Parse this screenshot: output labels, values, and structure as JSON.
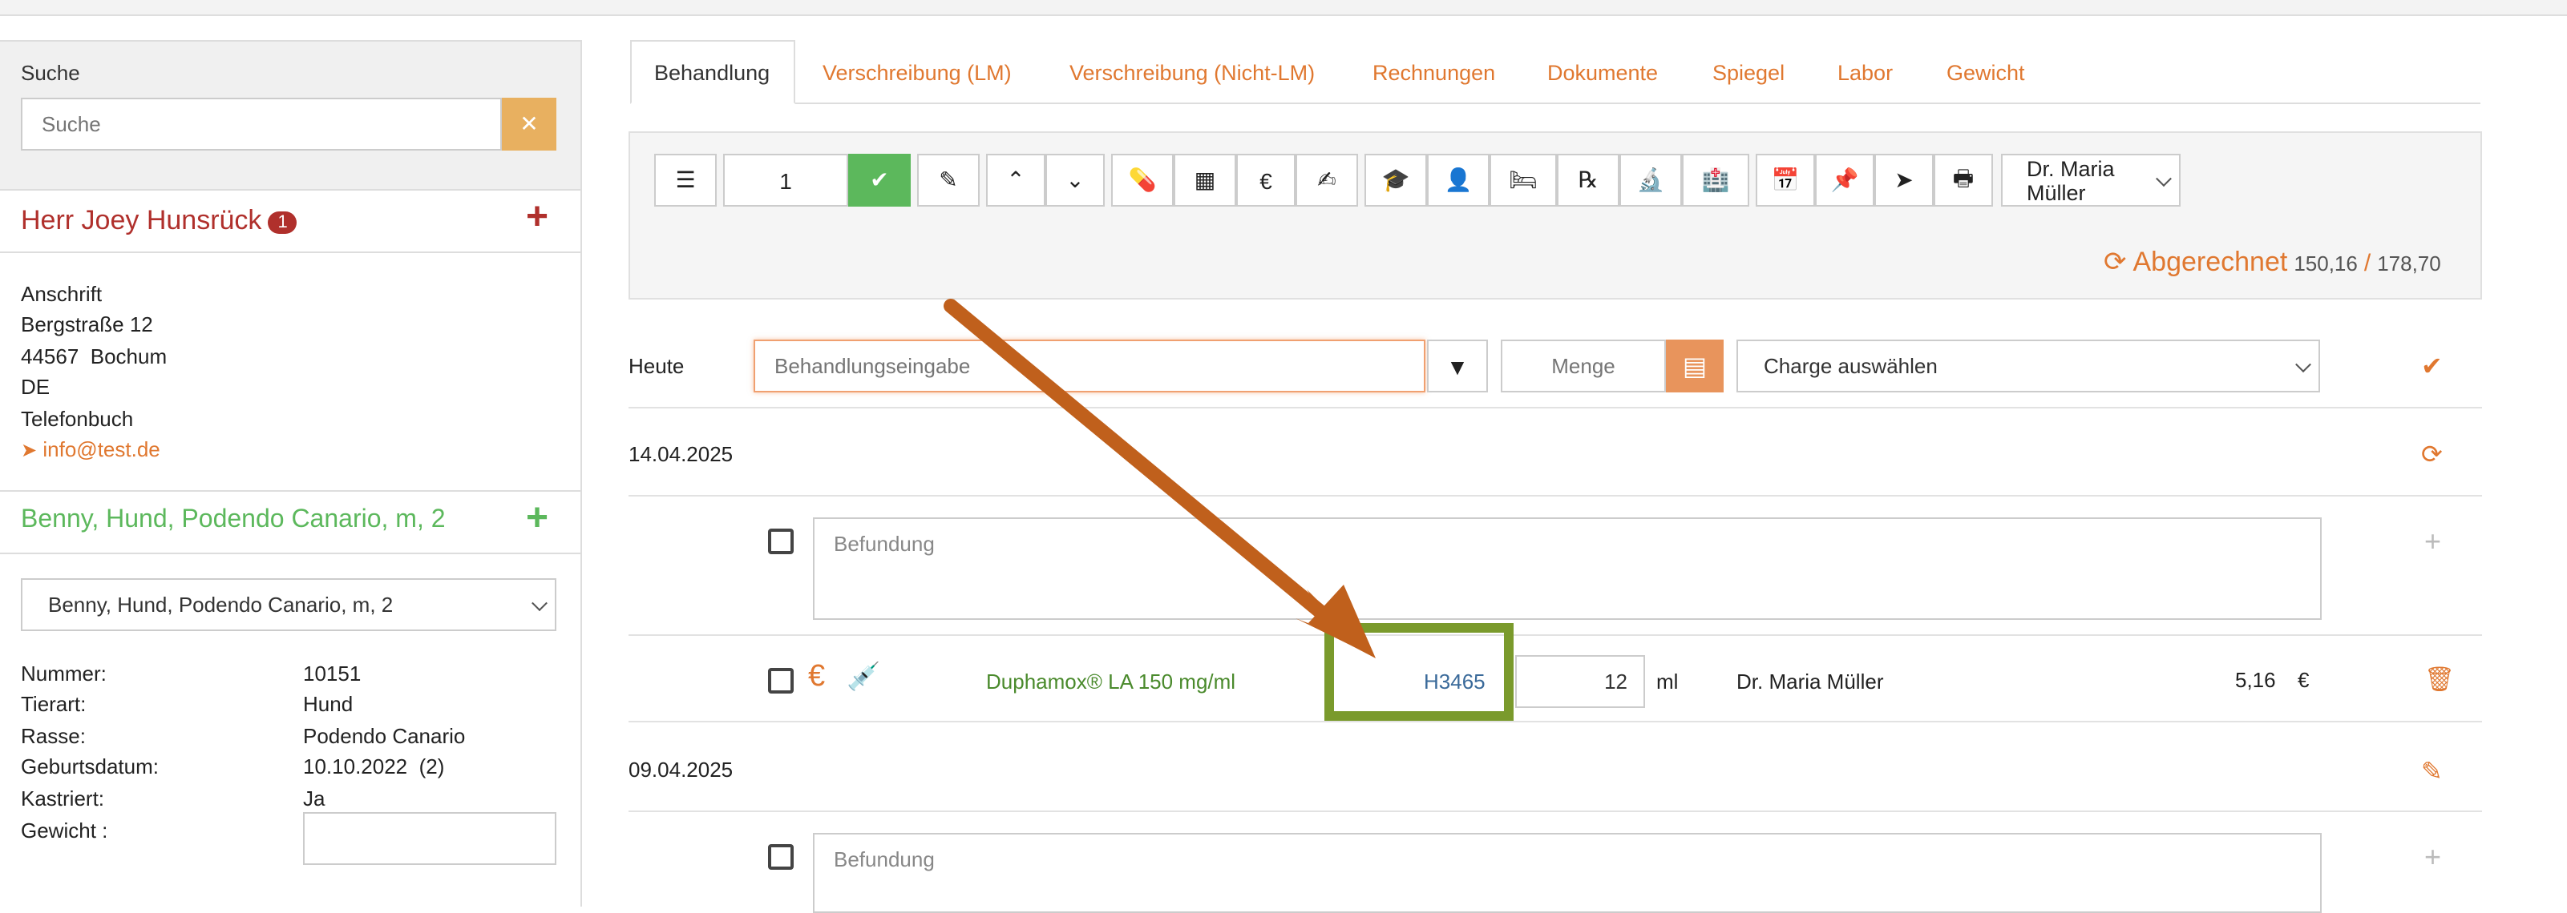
{
  "sidebar": {
    "search_label": "Suche",
    "search_placeholder": "Suche",
    "clear_icon": "x-icon",
    "owner_name": "Herr Joey Hunsrück",
    "owner_badge": "1",
    "address_label": "Anschrift",
    "street": "Bergstraße 12",
    "city": "44567  Bochum",
    "country": "DE",
    "phonebook": "Telefonbuch",
    "email": "info@test.de",
    "patient_name": "Benny, Hund, Podendo Canario, m, 2",
    "patient_select": "Benny, Hund, Podendo Canario, m, 2",
    "details": [
      {
        "label": "Nummer:",
        "value": "10151"
      },
      {
        "label": "Tierart:",
        "value": "Hund"
      },
      {
        "label": "Rasse:",
        "value": "Podendo Canario"
      },
      {
        "label": "Geburtsdatum:",
        "value": "10.10.2022  (2)"
      },
      {
        "label": "Kastriert:",
        "value": "Ja"
      },
      {
        "label": "Gewicht :",
        "value": ""
      }
    ]
  },
  "tabs": [
    "Behandlung",
    "Verschreibung (LM)",
    "Verschreibung (Nicht-LM)",
    "Rechnungen",
    "Dokumente",
    "Spiegel",
    "Labor",
    "Gewicht"
  ],
  "toolbar": {
    "count_value": "1",
    "doctor_select": "Dr. Maria Müller",
    "status": "Abgerechnet",
    "sum_billed": "150,16",
    "sum_divider": "/",
    "sum_total": "178,70",
    "icons": [
      "list-icon",
      "check-icon",
      "edit-icon",
      "chevron-up-icon",
      "chevron-down-icon",
      "pills-icon",
      "calendar-icon",
      "euro-icon",
      "signature-icon",
      "graduation-cap-icon",
      "user-icon",
      "bed-icon",
      "prescription-icon",
      "microscope-icon",
      "building-icon",
      "calendar-plus-icon",
      "pin-icon",
      "send-icon",
      "print-icon"
    ]
  },
  "entry": {
    "date_label": "Heute",
    "treatment_placeholder": "Behandlungseingabe",
    "quantity_placeholder": "Menge",
    "charge_select": "Charge auswählen"
  },
  "records": [
    {
      "date": "14.04.2025",
      "finding_placeholder": "Befundung",
      "item": {
        "medication": "Duphamox® LA 150 mg/ml",
        "charge": "H3465",
        "quantity": "12",
        "unit": "ml",
        "doctor": "Dr. Maria Müller",
        "price": "5,16",
        "currency": "€"
      }
    },
    {
      "date": "09.04.2025",
      "finding_placeholder": "Befundung"
    }
  ],
  "colors": {
    "accent_orange": "#e07830",
    "owner_red": "#b0302c",
    "patient_green": "#5cb85c",
    "highlight_box": "#7a9a2c",
    "arrow": "#c0601c"
  }
}
